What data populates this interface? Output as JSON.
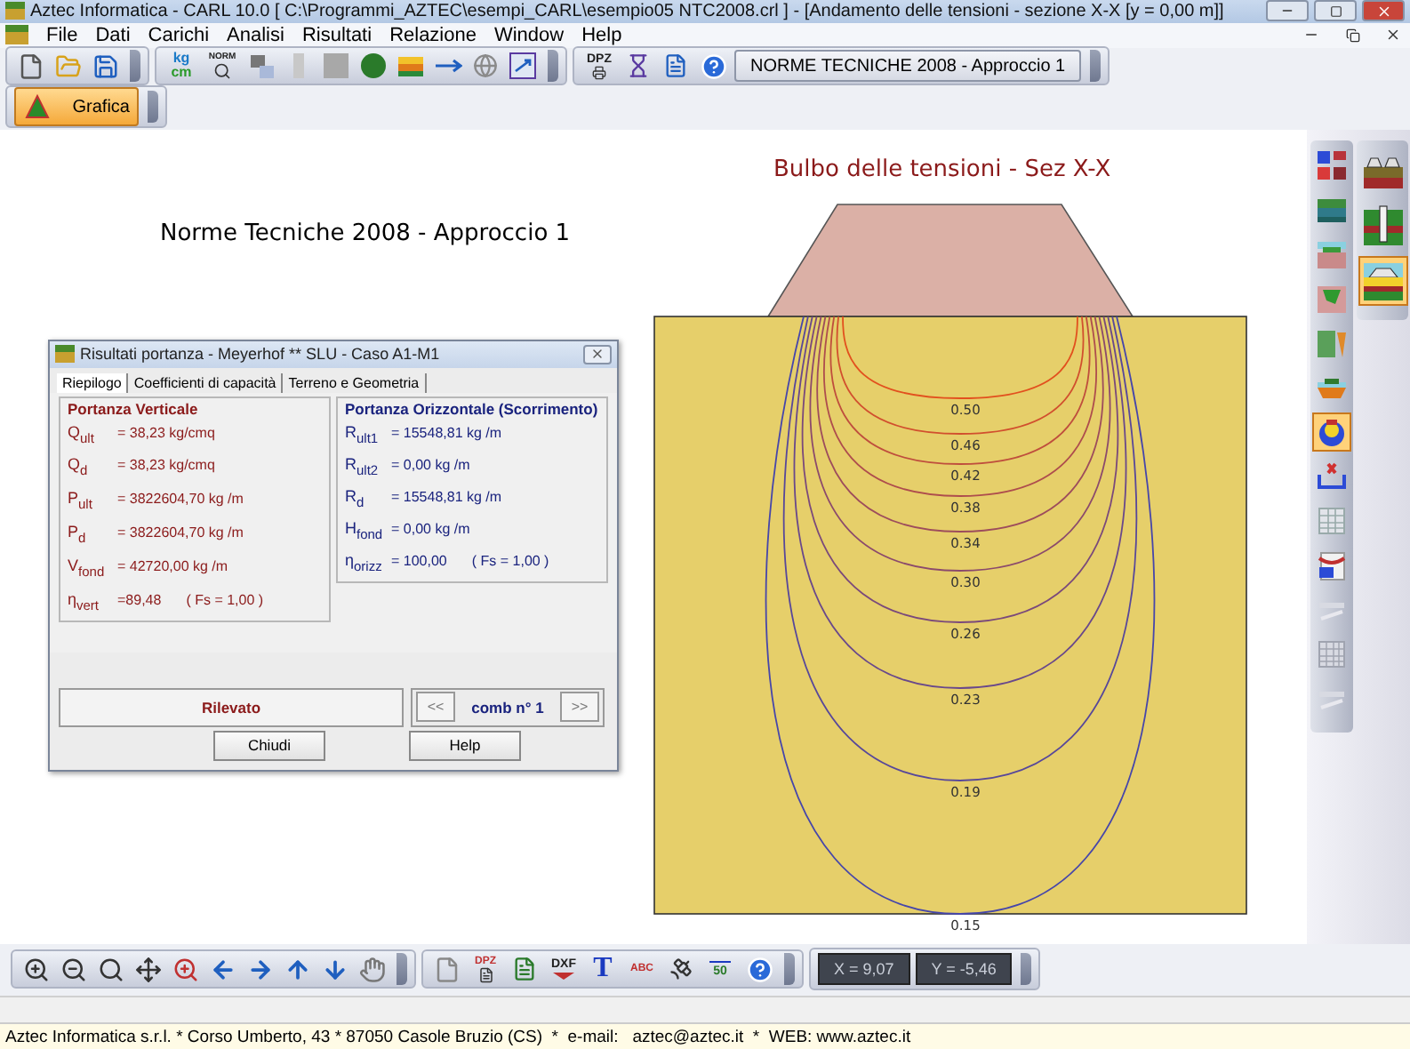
{
  "window": {
    "title": "Aztec Informatica - CARL 10.0 [ C:\\Programmi_AZTEC\\esempi_CARL\\esempio05 NTC2008.crl ] - [Andamento delle tensioni - sezione X-X [y = 0,00 m]]"
  },
  "menu": [
    {
      "label": "File"
    },
    {
      "label": "Dati"
    },
    {
      "label": "Carichi"
    },
    {
      "label": "Analisi"
    },
    {
      "label": "Risultati"
    },
    {
      "label": "Relazione"
    },
    {
      "label": "Window"
    },
    {
      "label": "Help"
    }
  ],
  "toolbar": {
    "units_top": "kg",
    "units_bottom": "cm",
    "norm_icon_text": "NORM",
    "dpz_icon_text": "DPZ",
    "norm_button": "NORME TECNICHE 2008 - Approccio 1"
  },
  "view_toolbar": {
    "button": {
      "label": "Grafica",
      "selected": true
    }
  },
  "drawing": {
    "subtitle": "Norme Tecniche 2008 - Approccio 1",
    "title": "Bulbo delle tensioni - Sez X-X",
    "contours": [
      {
        "label": "0.50"
      },
      {
        "label": "0.46"
      },
      {
        "label": "0.42"
      },
      {
        "label": "0.38"
      },
      {
        "label": "0.34"
      },
      {
        "label": "0.30"
      },
      {
        "label": "0.26"
      },
      {
        "label": "0.23"
      },
      {
        "label": "0.19"
      },
      {
        "label": "0.15"
      }
    ]
  },
  "dialog": {
    "title": "Risultati portanza - Meyerhof ** SLU - Caso A1-M1",
    "tabs": [
      {
        "label": "Riepilogo",
        "selected": true
      },
      {
        "label": "Coefficienti di capacità",
        "selected": false
      },
      {
        "label": "Terreno e Geometria",
        "selected": false
      }
    ],
    "vertical": {
      "heading": "Portanza Verticale",
      "rows": [
        {
          "symbol": "Q$_{ult}$",
          "value": "= 38,23 kg/cmq"
        },
        {
          "symbol": "Q$_{d}$",
          "value": "= 38,23 kg/cmq"
        },
        {
          "symbol": "P$_{ult}$",
          "value": "= 3822604,70 kg /m"
        },
        {
          "symbol": "P$_{d}$",
          "value": "= 3822604,70 kg /m"
        },
        {
          "symbol": "V$_{fond}$",
          "value": "= 42720,00 kg /m"
        },
        {
          "symbol": "η$_{vert}$",
          "value": "=89,48",
          "note": "( Fs = 1,00 )"
        }
      ]
    },
    "horizontal": {
      "heading": "Portanza Orizzontale (Scorrimento)",
      "rows": [
        {
          "symbol": "R$_{ult1}$",
          "value": "= 15548,81 kg /m"
        },
        {
          "symbol": "R$_{ult2}$",
          "value": "= 0,00 kg /m"
        },
        {
          "symbol": "R$_{d}$",
          "value": "= 15548,81 kg /m"
        },
        {
          "symbol": "H$_{fond}$",
          "value": "= 0,00 kg /m"
        },
        {
          "symbol": "η$_{orizz}$",
          "value": "= 100,00",
          "note": "( Fs = 1,00 )"
        }
      ]
    },
    "status": "Rilevato",
    "prev": "<<",
    "combination": "comb n° 1",
    "next": ">>",
    "buttons": [
      "Chiudi",
      "Help"
    ]
  },
  "tool_palette": [
    {
      "kind": "layout",
      "selected": false
    },
    {
      "kind": "layers",
      "selected": false
    },
    {
      "kind": "terrain",
      "selected": false
    },
    {
      "kind": "excavation",
      "selected": false
    },
    {
      "kind": "pile",
      "selected": false
    },
    {
      "kind": "footing",
      "selected": false
    },
    {
      "kind": "bulb",
      "selected": true
    },
    {
      "kind": "section",
      "selected": false
    },
    {
      "kind": "table",
      "selected": false
    },
    {
      "kind": "report",
      "selected": false
    },
    {
      "kind": "faded",
      "selected": false
    },
    {
      "kind": "grid",
      "selected": false
    },
    {
      "kind": "faded",
      "selected": false
    }
  ],
  "structure_palette": [
    {
      "kind": "footings",
      "selected": false
    },
    {
      "kind": "wall",
      "selected": false
    },
    {
      "kind": "embankment",
      "selected": true
    }
  ],
  "bottom_toolbar": {
    "dpz_icon_text": "DPZ",
    "dxf_icon_text": "DXF",
    "text_tool": "T",
    "abc_icon_text": "ABC",
    "scale_icon_text": "50",
    "x_readout": "X = 9,07",
    "y_readout": "Y = -5,46"
  },
  "status_bar": "Aztec Informatica s.r.l. * Corso Umberto, 43 * 87050 Casole Bruzio (CS)  *  e-mail:   aztec@aztec.it  *  WEB: www.aztec.it"
}
